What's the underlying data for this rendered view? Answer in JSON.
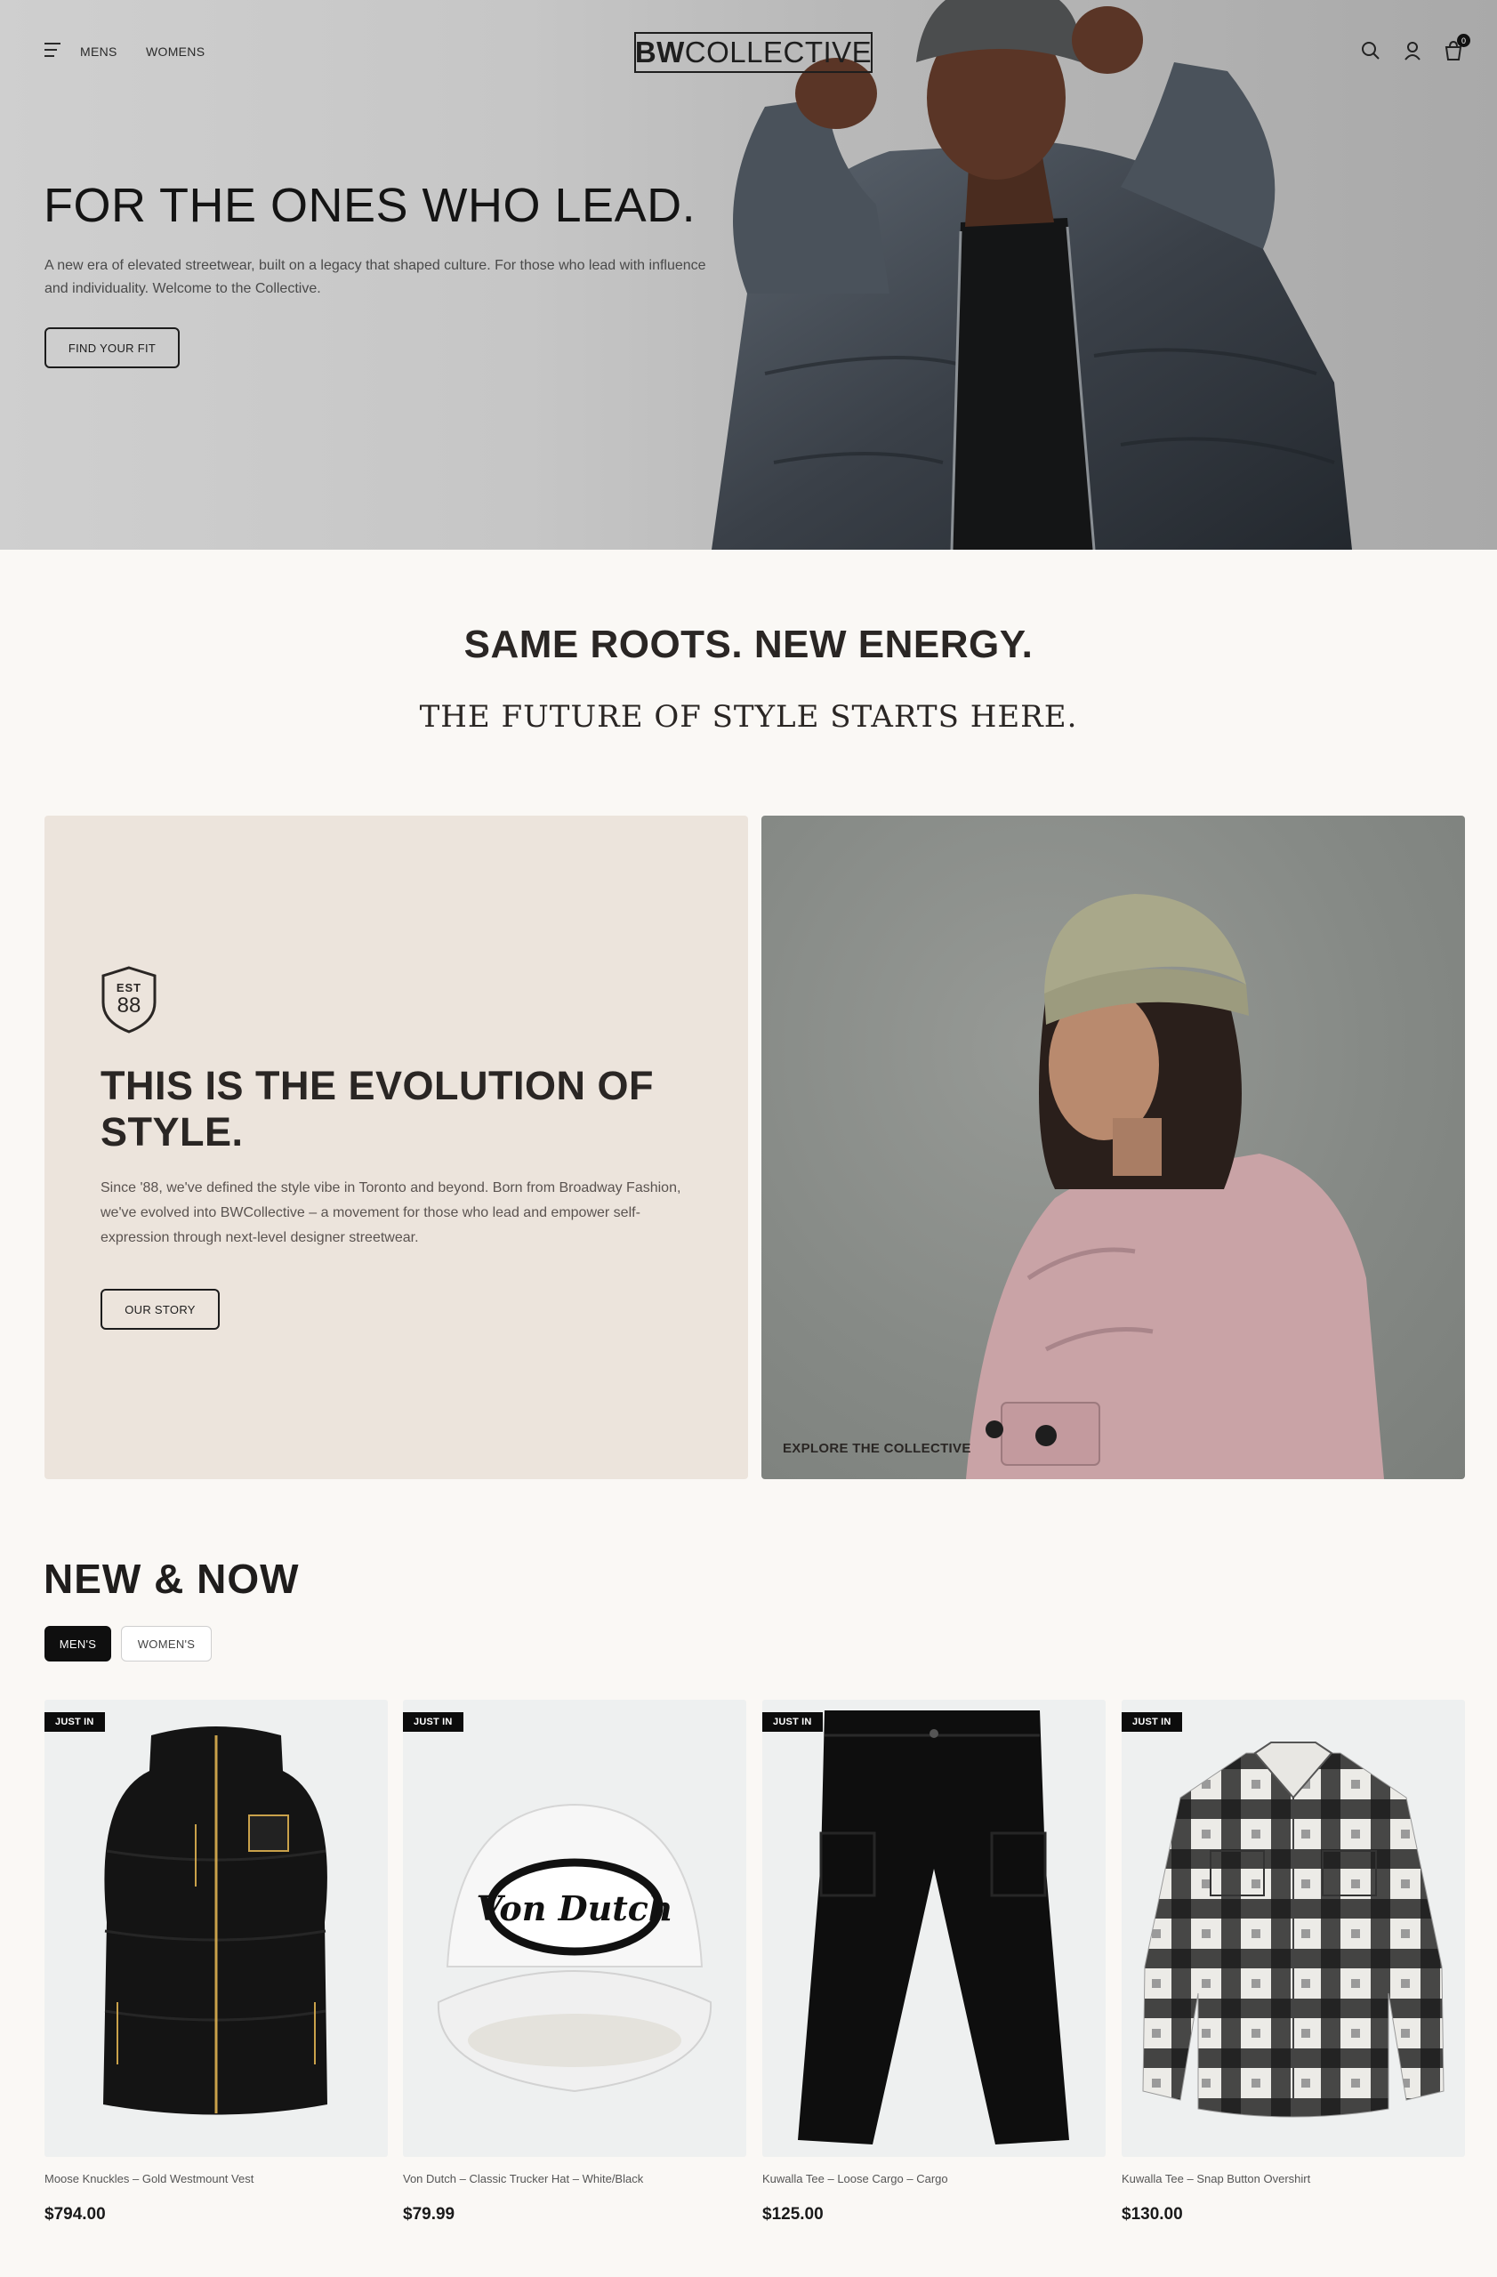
{
  "header": {
    "nav": [
      "MENS",
      "WOMENS"
    ],
    "logo_bold": "BW",
    "logo_rest": "COLLECTIVE",
    "cart_count": "0",
    "icons": [
      "menu-icon",
      "search-icon",
      "user-icon",
      "cart-icon"
    ]
  },
  "hero": {
    "title": "FOR THE ONES WHO LEAD.",
    "text": "A new era of elevated streetwear, built on a legacy that shaped culture. For those who lead with influence and individuality. Welcome to the Collective.",
    "cta": "FIND YOUR FIT"
  },
  "tagline": {
    "line1": "SAME ROOTS. NEW ENERGY.",
    "line2": "THE FUTURE OF STYLE STARTS HERE."
  },
  "evolution": {
    "badge_top": "EST",
    "badge_num": "88",
    "title": "THIS IS THE EVOLUTION OF STYLE.",
    "text": "Since '88, we've defined the style vibe in Toronto and beyond. Born from Broadway Fashion, we've evolved into BWCollective – a movement for those who lead and empower self-expression through next-level designer streetwear.",
    "cta": "OUR STORY",
    "explore": "EXPLORE THE COLLECTIVE"
  },
  "new_now": {
    "title": "NEW & NOW",
    "tabs": [
      "MEN'S",
      "WOMEN'S"
    ],
    "active_tab": "MEN'S",
    "products": [
      {
        "tag": "JUST IN",
        "name": "Moose Knuckles – Gold Westmount Vest",
        "price": "$794.00"
      },
      {
        "tag": "JUST IN",
        "name": "Von Dutch – Classic Trucker Hat – White/Black",
        "price": "$79.99"
      },
      {
        "tag": "JUST IN",
        "name": "Kuwalla Tee – Loose Cargo – Cargo",
        "price": "$125.00"
      },
      {
        "tag": "JUST IN",
        "name": "Kuwalla Tee – Snap Button Overshirt",
        "price": "$130.00"
      }
    ],
    "hat_logo_text": "Von Dutch"
  },
  "colors": {
    "background": "#faf8f5",
    "card_beige": "#ece4dc",
    "product_bg": "#eef0f0",
    "ink": "#1c1a19"
  }
}
